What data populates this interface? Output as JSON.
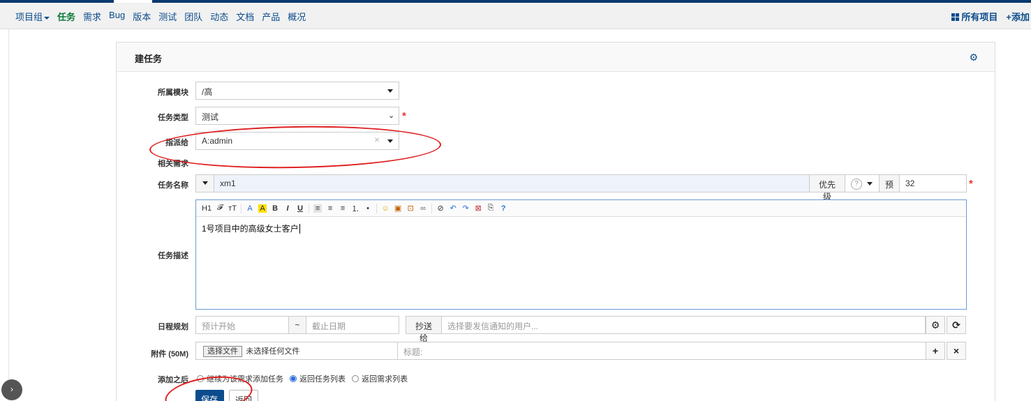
{
  "nav": {
    "items": [
      {
        "label": "项目组",
        "dropdown": true,
        "active": false
      },
      {
        "label": "任务",
        "active": true
      },
      {
        "label": "需求",
        "active": false
      },
      {
        "label": "Bug",
        "active": false
      },
      {
        "label": "版本",
        "active": false
      },
      {
        "label": "测试",
        "active": false
      },
      {
        "label": "团队",
        "active": false
      },
      {
        "label": "动态",
        "active": false
      },
      {
        "label": "文档",
        "active": false
      },
      {
        "label": "产品",
        "active": false
      },
      {
        "label": "概况",
        "active": false
      }
    ],
    "all_projects": "所有项目",
    "add": "添加"
  },
  "form": {
    "title": "建任务",
    "module": {
      "label": "所属模块",
      "value": "/高"
    },
    "type": {
      "label": "任务类型",
      "value": "测试"
    },
    "assign": {
      "label": "指派给",
      "value": "A:admin"
    },
    "story": {
      "label": "相关需求"
    },
    "name": {
      "label": "任务名称",
      "value": "xm1"
    },
    "priority": {
      "label": "优先级",
      "value": "?"
    },
    "estimate": {
      "label": "预",
      "value": "32"
    },
    "desc": {
      "label": "任务描述",
      "value": "1号项目中的高级女士客户"
    },
    "schedule": {
      "label": "日程规划",
      "start_placeholder": "预计开始",
      "tilde": "~",
      "end_placeholder": "截止日期"
    },
    "mailto": {
      "label": "抄送给",
      "placeholder": "选择要发信通知的用户..."
    },
    "files": {
      "label": "附件 (50M)",
      "choose": "选择文件",
      "none": "未选择任何文件",
      "title_placeholder": "标题:"
    },
    "after": {
      "label": "添加之后",
      "options": [
        {
          "label": "继续为该需求添加任务",
          "checked": false
        },
        {
          "label": "返回任务列表",
          "checked": true
        },
        {
          "label": "返回需求列表",
          "checked": false
        }
      ]
    },
    "save": "保存",
    "back": "返回"
  },
  "toolbar": [
    "H1",
    "𝓕",
    "тT",
    "A",
    "A",
    "B",
    "I",
    "U",
    "≡",
    "≡",
    "≡",
    "⒈",
    "•",
    "☺",
    "▣",
    "⊡",
    "∞",
    "⊘",
    "↶",
    "↷",
    "⊠",
    "⎘",
    "?"
  ],
  "colors": {
    "accent": "#0c4c8c",
    "active_nav": "#0c7a3c",
    "required": "#e33333",
    "annotation": "#e02020"
  }
}
